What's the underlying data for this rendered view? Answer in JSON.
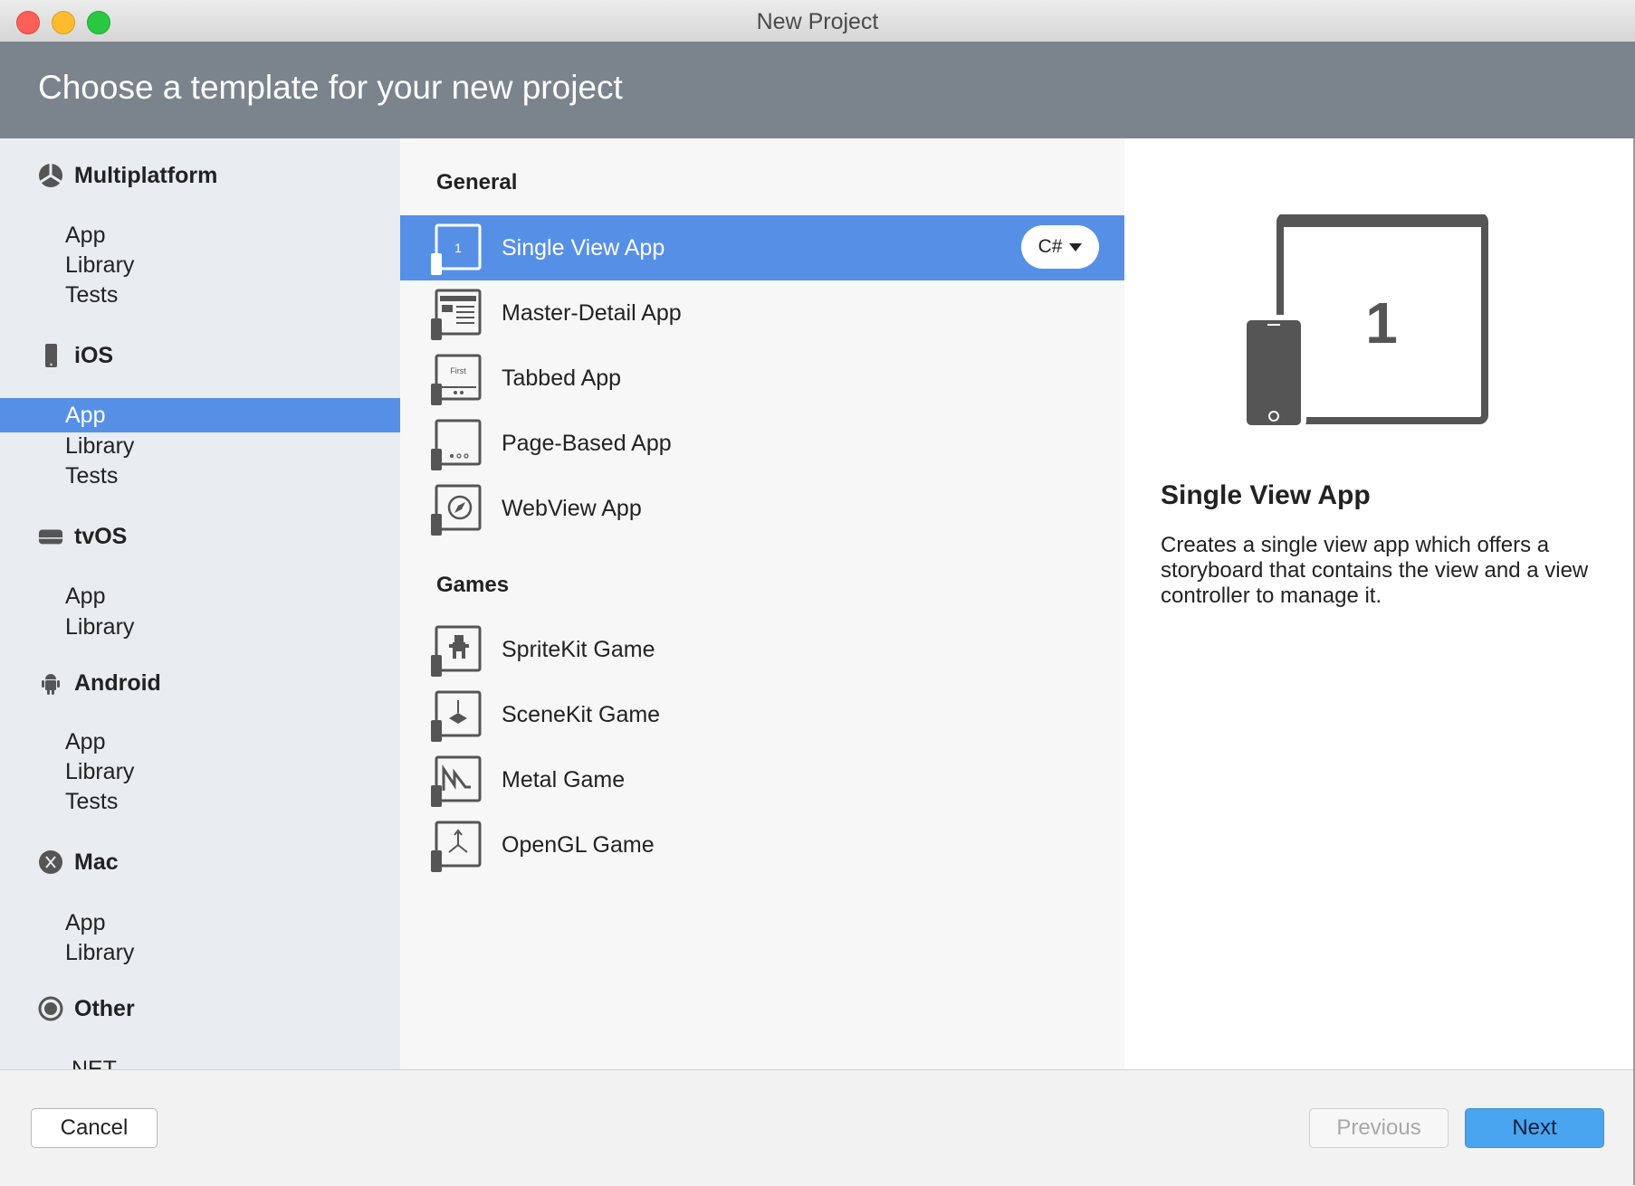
{
  "window": {
    "title": "New Project"
  },
  "header": {
    "title": "Choose a template for your new project"
  },
  "sidebar": {
    "categories": [
      {
        "label": "Multiplatform",
        "icon": "multiplatform-icon",
        "items": [
          "App",
          "Library",
          "Tests"
        ]
      },
      {
        "label": "iOS",
        "icon": "iphone-icon",
        "items": [
          "App",
          "Library",
          "Tests"
        ]
      },
      {
        "label": "tvOS",
        "icon": "appletv-icon",
        "items": [
          "App",
          "Library"
        ]
      },
      {
        "label": "Android",
        "icon": "android-icon",
        "items": [
          "App",
          "Library",
          "Tests"
        ]
      },
      {
        "label": "Mac",
        "icon": "mac-x-icon",
        "items": [
          "App",
          "Library"
        ]
      },
      {
        "label": "Other",
        "icon": "other-circle-icon",
        "items": [
          ".NET"
        ]
      }
    ],
    "selected": "iOS / App"
  },
  "templates": {
    "general_heading": "General",
    "general": [
      {
        "label": "Single View App",
        "icon": "single-view-app-icon"
      },
      {
        "label": "Master-Detail App",
        "icon": "master-detail-app-icon"
      },
      {
        "label": "Tabbed App",
        "icon": "tabbed-app-icon",
        "icon_text": "First"
      },
      {
        "label": "Page-Based App",
        "icon": "page-based-app-icon"
      },
      {
        "label": "WebView App",
        "icon": "webview-app-icon"
      }
    ],
    "games_heading": "Games",
    "games": [
      {
        "label": "SpriteKit Game",
        "icon": "spritekit-game-icon"
      },
      {
        "label": "SceneKit Game",
        "icon": "scenekit-game-icon"
      },
      {
        "label": "Metal Game",
        "icon": "metal-game-icon"
      },
      {
        "label": "OpenGL Game",
        "icon": "opengl-game-icon"
      }
    ],
    "language": "C#",
    "selected_icon_number": "1"
  },
  "detail": {
    "title": "Single View App",
    "description": "Creates a single view app which offers a storyboard that contains the view and a view controller to manage it.",
    "preview_number": "1"
  },
  "footer": {
    "cancel": "Cancel",
    "previous": "Previous",
    "next": "Next"
  },
  "colors": {
    "header": "#7b848d",
    "selection": "#5690e6",
    "next_button": "#4aa5f0",
    "sidebar": "#e9ecf0"
  }
}
